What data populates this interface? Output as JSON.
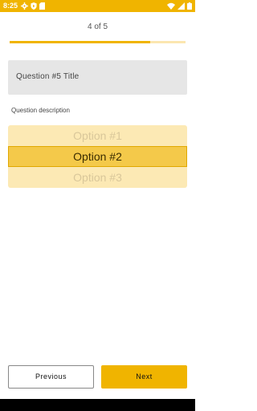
{
  "status_bar": {
    "time": "8:25",
    "background_color": "#f0b400",
    "left_icons": [
      "gear-icon",
      "play-protect-icon",
      "sd-card-icon"
    ],
    "right_icons": [
      "wifi-icon",
      "cellular-signal-icon",
      "battery-icon"
    ]
  },
  "progress": {
    "label": "4 of 5",
    "current": 4,
    "total": 5,
    "fraction": 0.8,
    "fill_color": "#f0b400",
    "track_color": "#fbe6b0"
  },
  "question": {
    "title_text": "Question #5 Title",
    "description": "Question description"
  },
  "picker": {
    "options": [
      "Option #1",
      "Option #2",
      "Option #3"
    ],
    "selected": "Option #2",
    "highlight_color": "#f4c94a"
  },
  "buttons": {
    "previous_label": "Previous",
    "next_label": "Next"
  }
}
